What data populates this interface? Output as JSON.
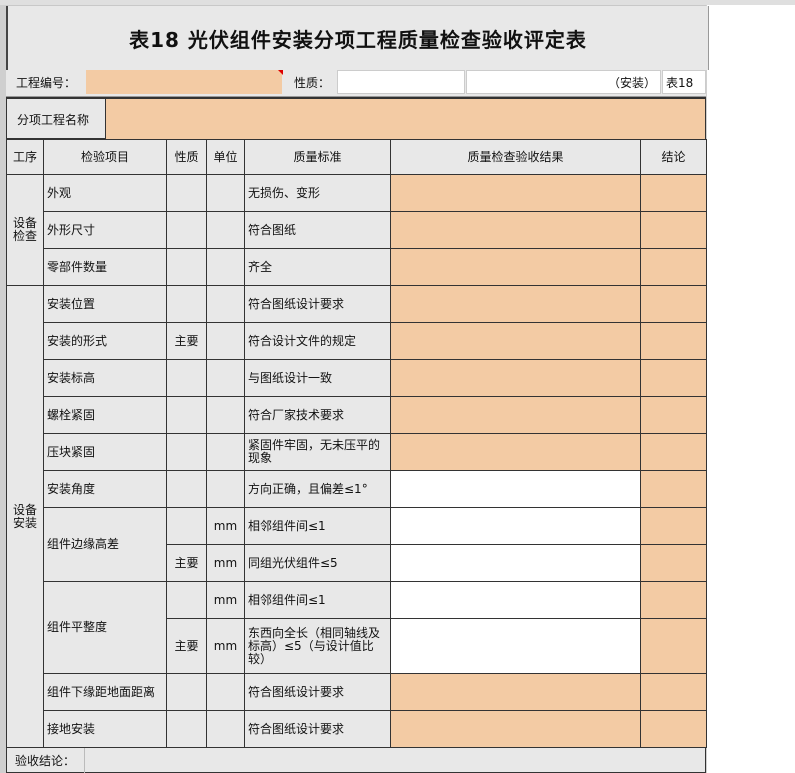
{
  "form": {
    "title": "表18  光伏组件安装分项工程质量检查验收评定表",
    "project_no_label": "工程编号：",
    "nature_label": "性质：",
    "installation_tag": "（安装）",
    "table_no": "表18",
    "subproject_label": "分项工程名称"
  },
  "headers": {
    "process": "工序",
    "item": "检验项目",
    "nature": "性质",
    "unit": "单位",
    "standard": "质量标准",
    "result": "质量检查验收结果",
    "conclusion": "结论"
  },
  "groups": {
    "inspection": "设备\n检查",
    "install": "设备\n安装"
  },
  "rows": [
    {
      "item": "外观",
      "nature": "",
      "unit": "",
      "standard": "无损伤、变形",
      "result_fill": "orange"
    },
    {
      "item": "外形尺寸",
      "nature": "",
      "unit": "",
      "standard": "符合图纸",
      "result_fill": "orange"
    },
    {
      "item": "零部件数量",
      "nature": "",
      "unit": "",
      "standard": "齐全",
      "result_fill": "orange"
    },
    {
      "item": "安装位置",
      "nature": "",
      "unit": "",
      "standard": "符合图纸设计要求",
      "result_fill": "orange"
    },
    {
      "item": "安装的形式",
      "nature": "主要",
      "unit": "",
      "standard": "符合设计文件的规定",
      "result_fill": "orange"
    },
    {
      "item": "安装标高",
      "nature": "",
      "unit": "",
      "standard": "与图纸设计一致",
      "result_fill": "orange"
    },
    {
      "item": "螺栓紧固",
      "nature": "",
      "unit": "",
      "standard": "符合厂家技术要求",
      "result_fill": "orange"
    },
    {
      "item": "压块紧固",
      "nature": "",
      "unit": "",
      "standard": "紧固件牢固，无未压平的现象",
      "result_fill": "orange"
    },
    {
      "item": "安装角度",
      "nature": "",
      "unit": "",
      "standard": "方向正确，且偏差≤1°",
      "result_fill": "white"
    },
    {
      "item": "组件边缘高差",
      "nature": "",
      "unit": "mm",
      "standard": "相邻组件间≤1",
      "result_fill": "white"
    },
    {
      "item": "",
      "nature": "主要",
      "unit": "mm",
      "standard": "同组光伏组件≤5",
      "result_fill": "white"
    },
    {
      "item": "组件平整度",
      "nature": "",
      "unit": "mm",
      "standard": "相邻组件间≤1",
      "result_fill": "white"
    },
    {
      "item": "",
      "nature": "主要",
      "unit": "mm",
      "standard": "东西向全长（相同轴线及标高）≤5（与设计值比较）",
      "result_fill": "white"
    },
    {
      "item": "组件下缘距地面距离",
      "nature": "",
      "unit": "",
      "standard": "符合图纸设计要求",
      "result_fill": "orange"
    },
    {
      "item": "接地安装",
      "nature": "",
      "unit": "",
      "standard": "符合图纸设计要求",
      "result_fill": "orange"
    }
  ],
  "footer": {
    "acceptance_label": "验收结论："
  }
}
